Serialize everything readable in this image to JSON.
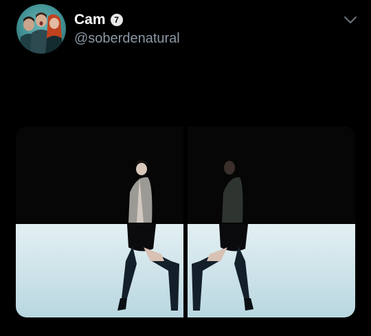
{
  "tweet": {
    "author": {
      "display_name": "Cam",
      "verified_badge": "7",
      "handle": "@soberdenatural",
      "avatar_icon": "group-photo-avatar"
    },
    "menu_icon": "chevron-down-icon",
    "media": {
      "type": "image-grid",
      "panel_count": 2
    }
  },
  "colors": {
    "background": "#000000",
    "name": "#ffffff",
    "handle": "#8b98a5",
    "floor": "#cde4ec"
  }
}
